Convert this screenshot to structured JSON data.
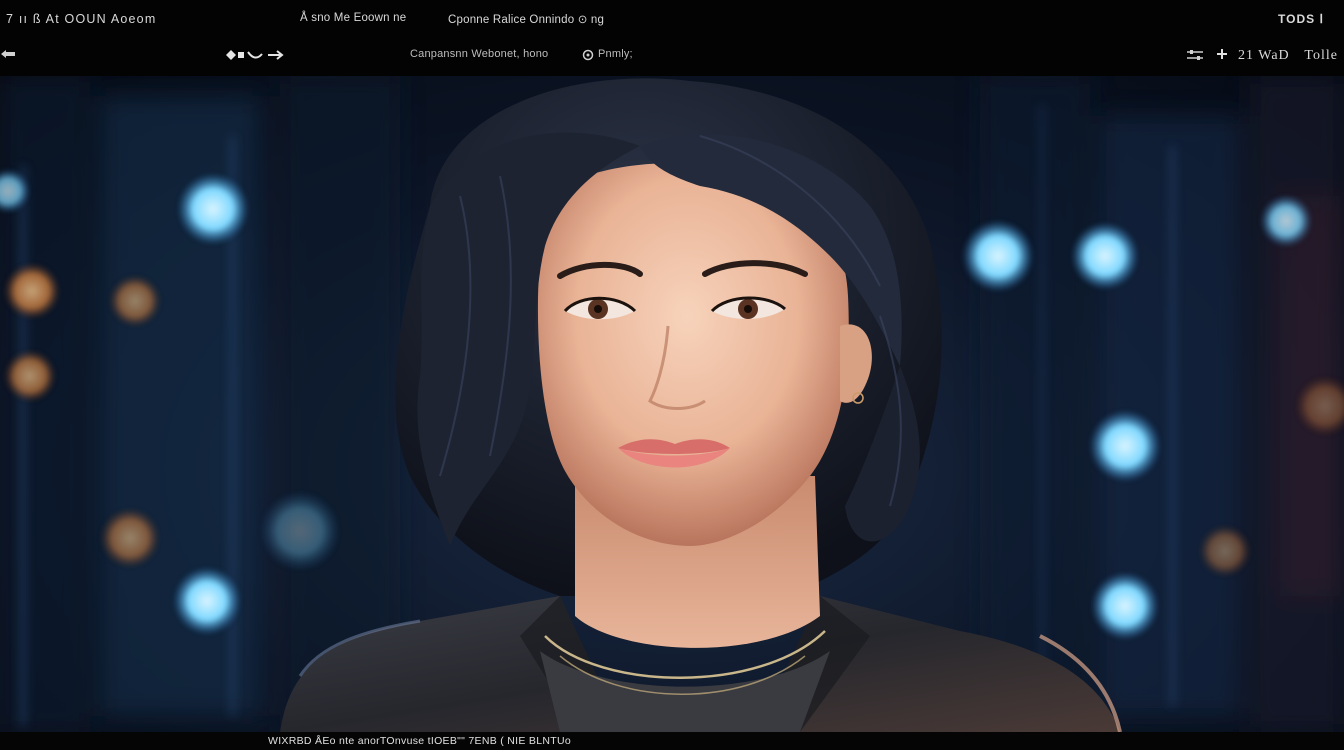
{
  "header": {
    "brand": "7 ıı ß At OOUN Aoeom",
    "info": "Å sno Me Eoown ne",
    "controls": "Cponne Ralice Onnindo ⊙ ng",
    "right_label": "TODS Ⅰ",
    "path": "Canpansnn Webonet, hono",
    "mode": "Pnmly;",
    "zoom": "21 WaD",
    "tools": "Tolle"
  },
  "icons": {
    "left": "arrow-left-icon",
    "nav": "nav-arrows-icon",
    "mode": "circle-icon",
    "sliders": "sliders-icon",
    "add": "add-icon"
  },
  "status": {
    "text": "WIXRBD ÅEo nte anorTOnvuse tIOEB\"\" 7ENB ( NIE BLNTUo"
  },
  "colors": {
    "background": "#000000",
    "chrome": "#030303",
    "bokeh_blue": "#7fd8ff",
    "bokeh_amber": "#e7a45c"
  }
}
